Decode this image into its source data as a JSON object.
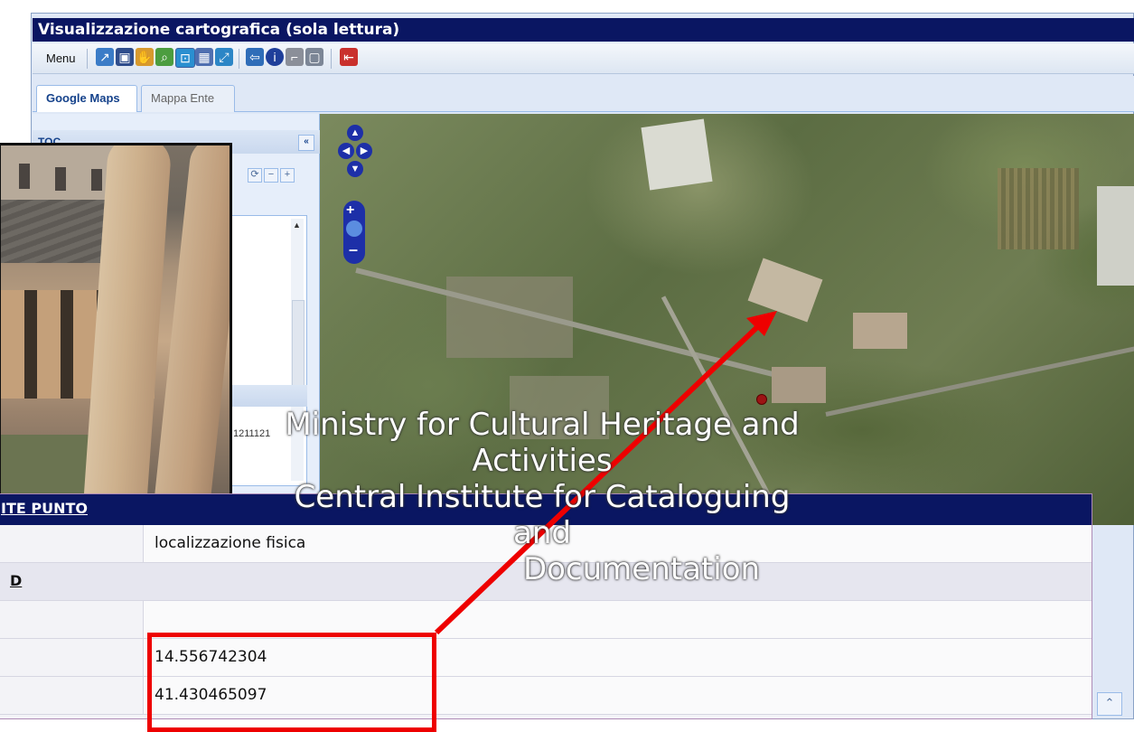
{
  "window": {
    "title": "Visualizzazione cartografica (sola lettura)",
    "menu_label": "Menu"
  },
  "tabs": [
    {
      "label": "Google Maps",
      "active": true
    },
    {
      "label": "Mappa Ente",
      "active": false
    }
  ],
  "toc": {
    "title": "TOC",
    "collapse_glyph": "«",
    "tree_fragment_text": "1211121"
  },
  "toolbar_icons": [
    "export-icon",
    "save-icon",
    "pan-hand-icon",
    "zoom-icon",
    "zoom-box-icon",
    "full-extent-icon",
    "fit-icon",
    "back-icon",
    "info-icon",
    "measure-icon",
    "select-icon",
    "exit-icon"
  ],
  "map": {
    "nav_up": "▲",
    "nav_left": "◀",
    "nav_right": "▶",
    "nav_down": "▼",
    "zoom_in": "+",
    "zoom_out": "–"
  },
  "detail": {
    "header_title": "ITE PUNTO",
    "rows": [
      {
        "label": "",
        "value": "localizzazione fisica"
      },
      {
        "label": "D",
        "value": ""
      },
      {
        "label": "",
        "value": ""
      },
      {
        "label": "",
        "value": "14.556742304"
      },
      {
        "label": "",
        "value": "41.430465097"
      }
    ]
  },
  "watermark": {
    "line1": "Ministry for Cultural Heritage and Activities",
    "line2": "Central Institute for Cataloguing and",
    "line3": "Documentation"
  },
  "colors": {
    "title_bar": "#0a1662",
    "annotation_red": "#ee0000",
    "accent_blue": "#1d2fa8"
  }
}
